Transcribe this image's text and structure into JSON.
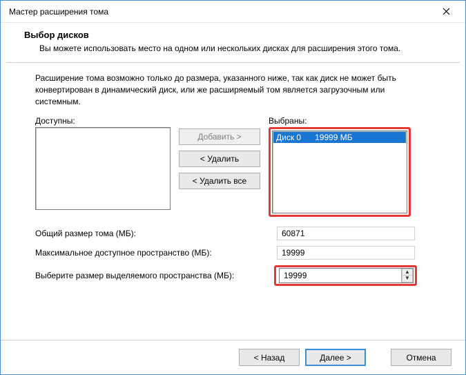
{
  "window": {
    "title": "Мастер расширения тома"
  },
  "header": {
    "title": "Выбор дисков",
    "description": "Вы можете использовать место на одном или нескольких дисках для расширения этого тома."
  },
  "intro": "Расширение тома возможно только до размера, указанного ниже, так как диск не может быть конвертирован в динамический диск, или же расширяемый том является загрузочным или системным.",
  "lists": {
    "available_label": "Доступны:",
    "selected_label": "Выбраны:",
    "selected_items": [
      {
        "text": "Диск 0      19999 МБ",
        "selected": true
      }
    ]
  },
  "buttons": {
    "add": "Добавить >",
    "remove": "< Удалить",
    "remove_all": "< Удалить все"
  },
  "fields": {
    "total_label": "Общий размер тома (МБ):",
    "total_value": "60871",
    "max_label": "Максимальное доступное пространство (МБ):",
    "max_value": "19999",
    "choose_label": "Выберите размер выделяемого пространства (МБ):",
    "choose_value": "19999"
  },
  "footer": {
    "back": "< Назад",
    "next": "Далее >",
    "cancel": "Отмена"
  }
}
